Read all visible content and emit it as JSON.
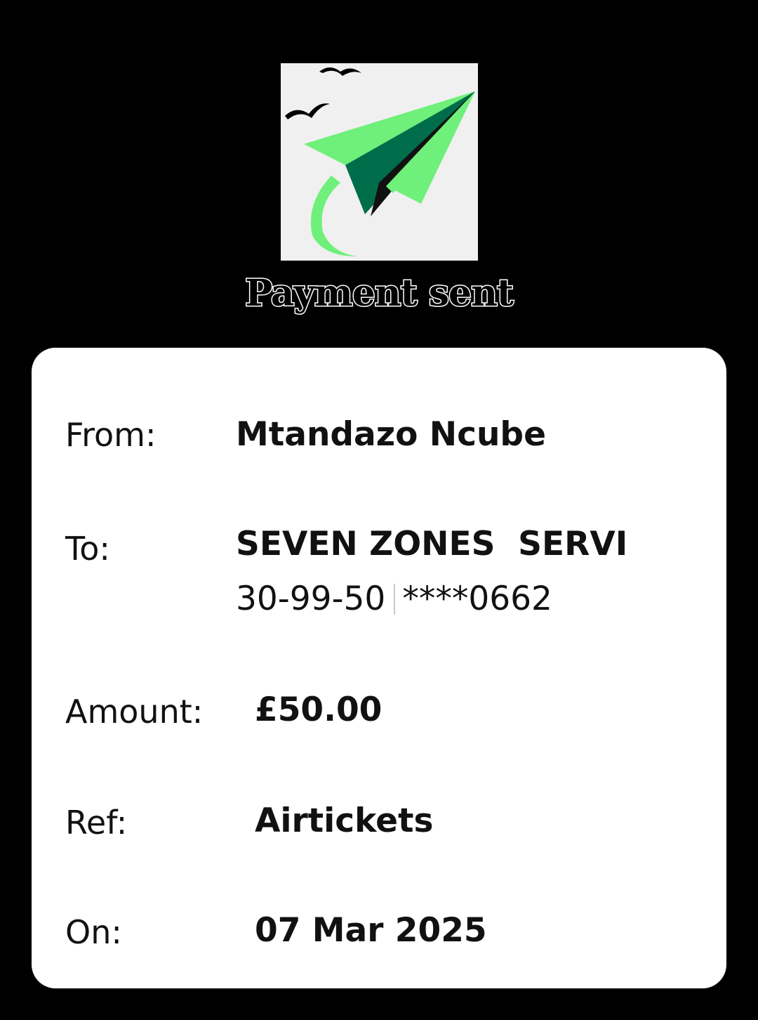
{
  "header": {
    "logo_icon": "paper-plane-icon",
    "title": "Payment sent"
  },
  "colors": {
    "background": "#000000",
    "card": "#ffffff",
    "plane_light": "#6ff07a",
    "plane_dark": "#006d4a",
    "logo_bg": "#f0f0f0"
  },
  "details": {
    "from_label": "From:",
    "from_value": "Mtandazo Ncube",
    "to_label": "To:",
    "to_value": "SEVEN ZONES  SERVI",
    "sort_code": "30-99-50",
    "account_number": "****0662",
    "amount_label": "Amount:",
    "amount_value": "£50.00",
    "ref_label": "Ref:",
    "ref_value": "Airtickets",
    "on_label": "On:",
    "on_value": "07 Mar 2025"
  }
}
